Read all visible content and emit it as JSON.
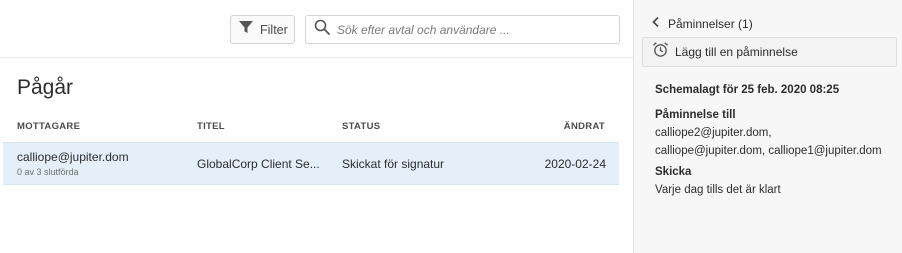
{
  "toolbar": {
    "filter_label": "Filter",
    "search_placeholder": "Sök efter avtal och användare ..."
  },
  "section": {
    "title": "Pågår"
  },
  "table": {
    "headers": {
      "recipient": "MOTTAGARE",
      "title": "TITEL",
      "status": "STATUS",
      "changed": "ÄNDRAT"
    },
    "rows": [
      {
        "recipient": "calliope@jupiter.dom",
        "progress": "0 av 3 slutförda",
        "title": "GlobalCorp Client Se...",
        "status": "Skickat för signatur",
        "changed": "2020-02-24"
      }
    ]
  },
  "panel": {
    "back_label": "Påminnelser (1)",
    "add_label": "Lägg till en påminnelse",
    "scheduled": "Schemalagt för 25 feb. 2020 08:25",
    "reminder_to_label": "Påminnelse till",
    "reminder_to_line1": "calliope2@jupiter.dom,",
    "reminder_to_line2": "calliope@jupiter.dom, calliope1@jupiter.dom",
    "send_label": "Skicka",
    "send_value": "Varje dag tills det är klart"
  },
  "icons": {
    "filter": "filter-icon",
    "search": "search-icon",
    "back": "chevron-left-icon",
    "alarm": "alarm-clock-icon"
  },
  "colors": {
    "row_selected": "#e5eff9",
    "panel_bg": "#f7f7f7",
    "text": "#2c2c2c"
  }
}
